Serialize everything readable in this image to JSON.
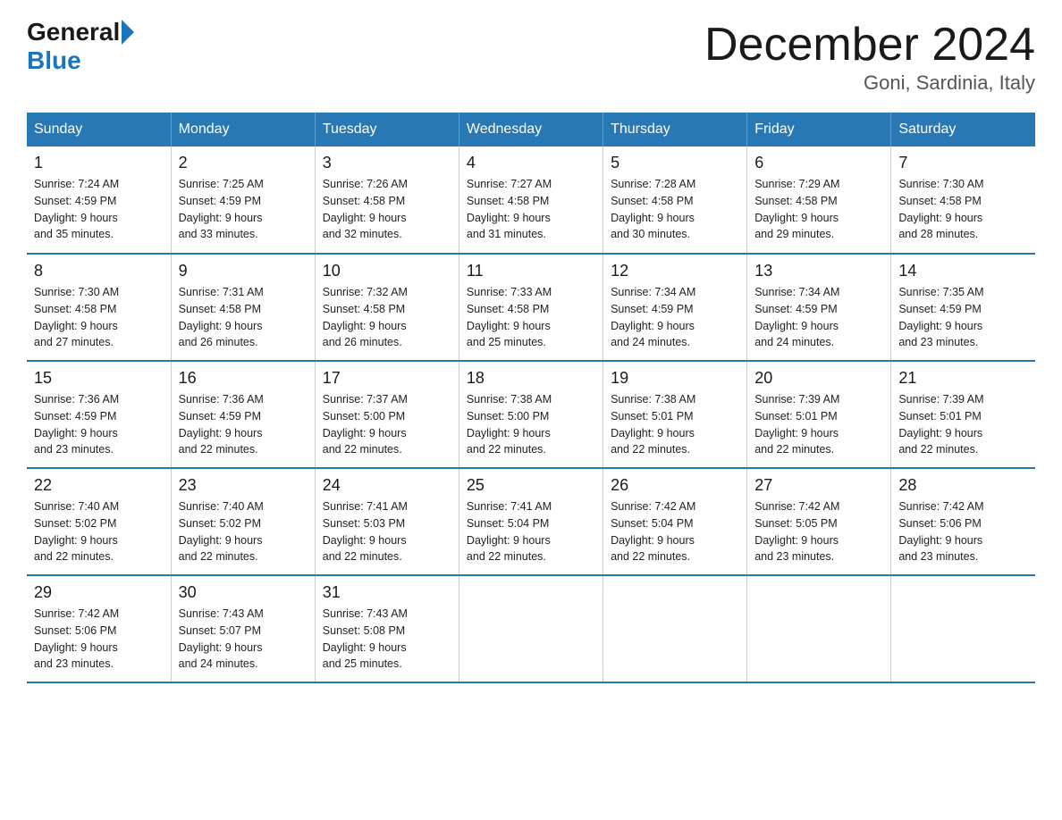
{
  "logo": {
    "general": "General",
    "blue": "Blue"
  },
  "header": {
    "month": "December 2024",
    "location": "Goni, Sardinia, Italy"
  },
  "days_of_week": [
    "Sunday",
    "Monday",
    "Tuesday",
    "Wednesday",
    "Thursday",
    "Friday",
    "Saturday"
  ],
  "weeks": [
    [
      {
        "num": "1",
        "sunrise": "7:24 AM",
        "sunset": "4:59 PM",
        "daylight": "9 hours and 35 minutes."
      },
      {
        "num": "2",
        "sunrise": "7:25 AM",
        "sunset": "4:59 PM",
        "daylight": "9 hours and 33 minutes."
      },
      {
        "num": "3",
        "sunrise": "7:26 AM",
        "sunset": "4:58 PM",
        "daylight": "9 hours and 32 minutes."
      },
      {
        "num": "4",
        "sunrise": "7:27 AM",
        "sunset": "4:58 PM",
        "daylight": "9 hours and 31 minutes."
      },
      {
        "num": "5",
        "sunrise": "7:28 AM",
        "sunset": "4:58 PM",
        "daylight": "9 hours and 30 minutes."
      },
      {
        "num": "6",
        "sunrise": "7:29 AM",
        "sunset": "4:58 PM",
        "daylight": "9 hours and 29 minutes."
      },
      {
        "num": "7",
        "sunrise": "7:30 AM",
        "sunset": "4:58 PM",
        "daylight": "9 hours and 28 minutes."
      }
    ],
    [
      {
        "num": "8",
        "sunrise": "7:30 AM",
        "sunset": "4:58 PM",
        "daylight": "9 hours and 27 minutes."
      },
      {
        "num": "9",
        "sunrise": "7:31 AM",
        "sunset": "4:58 PM",
        "daylight": "9 hours and 26 minutes."
      },
      {
        "num": "10",
        "sunrise": "7:32 AM",
        "sunset": "4:58 PM",
        "daylight": "9 hours and 26 minutes."
      },
      {
        "num": "11",
        "sunrise": "7:33 AM",
        "sunset": "4:58 PM",
        "daylight": "9 hours and 25 minutes."
      },
      {
        "num": "12",
        "sunrise": "7:34 AM",
        "sunset": "4:59 PM",
        "daylight": "9 hours and 24 minutes."
      },
      {
        "num": "13",
        "sunrise": "7:34 AM",
        "sunset": "4:59 PM",
        "daylight": "9 hours and 24 minutes."
      },
      {
        "num": "14",
        "sunrise": "7:35 AM",
        "sunset": "4:59 PM",
        "daylight": "9 hours and 23 minutes."
      }
    ],
    [
      {
        "num": "15",
        "sunrise": "7:36 AM",
        "sunset": "4:59 PM",
        "daylight": "9 hours and 23 minutes."
      },
      {
        "num": "16",
        "sunrise": "7:36 AM",
        "sunset": "4:59 PM",
        "daylight": "9 hours and 22 minutes."
      },
      {
        "num": "17",
        "sunrise": "7:37 AM",
        "sunset": "5:00 PM",
        "daylight": "9 hours and 22 minutes."
      },
      {
        "num": "18",
        "sunrise": "7:38 AM",
        "sunset": "5:00 PM",
        "daylight": "9 hours and 22 minutes."
      },
      {
        "num": "19",
        "sunrise": "7:38 AM",
        "sunset": "5:01 PM",
        "daylight": "9 hours and 22 minutes."
      },
      {
        "num": "20",
        "sunrise": "7:39 AM",
        "sunset": "5:01 PM",
        "daylight": "9 hours and 22 minutes."
      },
      {
        "num": "21",
        "sunrise": "7:39 AM",
        "sunset": "5:01 PM",
        "daylight": "9 hours and 22 minutes."
      }
    ],
    [
      {
        "num": "22",
        "sunrise": "7:40 AM",
        "sunset": "5:02 PM",
        "daylight": "9 hours and 22 minutes."
      },
      {
        "num": "23",
        "sunrise": "7:40 AM",
        "sunset": "5:02 PM",
        "daylight": "9 hours and 22 minutes."
      },
      {
        "num": "24",
        "sunrise": "7:41 AM",
        "sunset": "5:03 PM",
        "daylight": "9 hours and 22 minutes."
      },
      {
        "num": "25",
        "sunrise": "7:41 AM",
        "sunset": "5:04 PM",
        "daylight": "9 hours and 22 minutes."
      },
      {
        "num": "26",
        "sunrise": "7:42 AM",
        "sunset": "5:04 PM",
        "daylight": "9 hours and 22 minutes."
      },
      {
        "num": "27",
        "sunrise": "7:42 AM",
        "sunset": "5:05 PM",
        "daylight": "9 hours and 23 minutes."
      },
      {
        "num": "28",
        "sunrise": "7:42 AM",
        "sunset": "5:06 PM",
        "daylight": "9 hours and 23 minutes."
      }
    ],
    [
      {
        "num": "29",
        "sunrise": "7:42 AM",
        "sunset": "5:06 PM",
        "daylight": "9 hours and 23 minutes."
      },
      {
        "num": "30",
        "sunrise": "7:43 AM",
        "sunset": "5:07 PM",
        "daylight": "9 hours and 24 minutes."
      },
      {
        "num": "31",
        "sunrise": "7:43 AM",
        "sunset": "5:08 PM",
        "daylight": "9 hours and 25 minutes."
      },
      null,
      null,
      null,
      null
    ]
  ]
}
